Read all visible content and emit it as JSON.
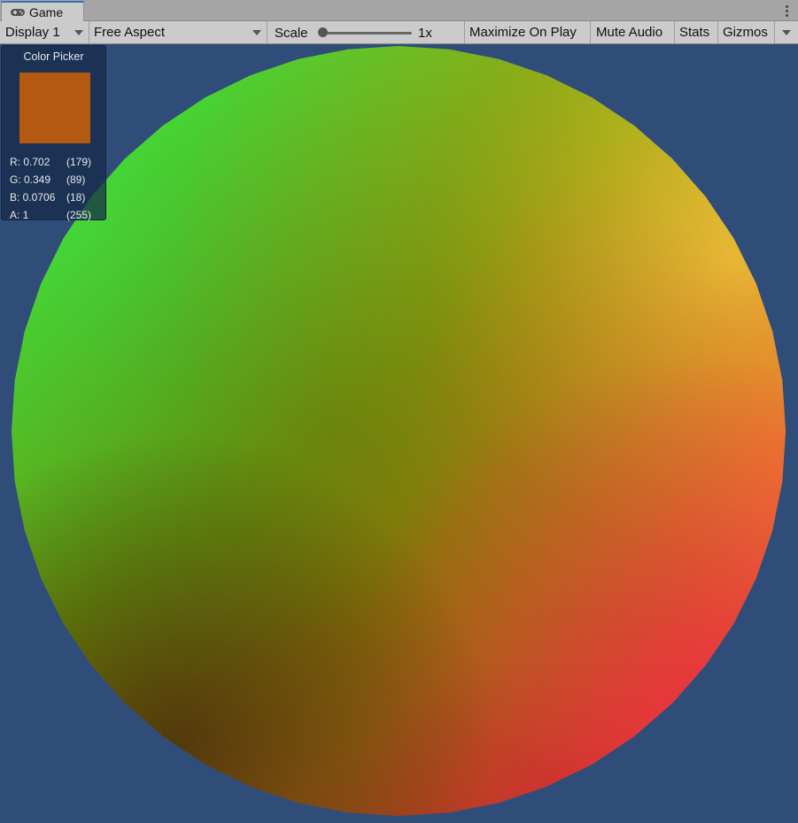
{
  "window": {
    "tab_label": "Game",
    "tab_icon": "gamepad-icon",
    "menu_icon": "kebab-menu-icon"
  },
  "toolbar": {
    "display_label": "Display 1",
    "aspect_label": "Free Aspect",
    "scale_label": "Scale",
    "scale_value": "1x",
    "scale_level": 0.0,
    "maximize_label": "Maximize On Play",
    "mute_label": "Mute Audio",
    "stats_label": "Stats",
    "gizmos_label": "Gizmos"
  },
  "viewport": {
    "background_color": "#304d7a"
  },
  "color_picker": {
    "title": "Color Picker",
    "swatch_color": "#b35912",
    "r": {
      "label": "R: 0.702",
      "byte": "(179)"
    },
    "g": {
      "label": "G: 0.349",
      "byte": "(89)"
    },
    "b": {
      "label": "B: 0.0706",
      "byte": "(18)"
    },
    "a": {
      "label": "A: 1",
      "byte": "(255)"
    }
  },
  "colors": {
    "accent": "#3a72b0",
    "sphere_green": "#3ee23a",
    "sphere_yellow": "#d8d836",
    "sphere_red": "#e0303c"
  }
}
